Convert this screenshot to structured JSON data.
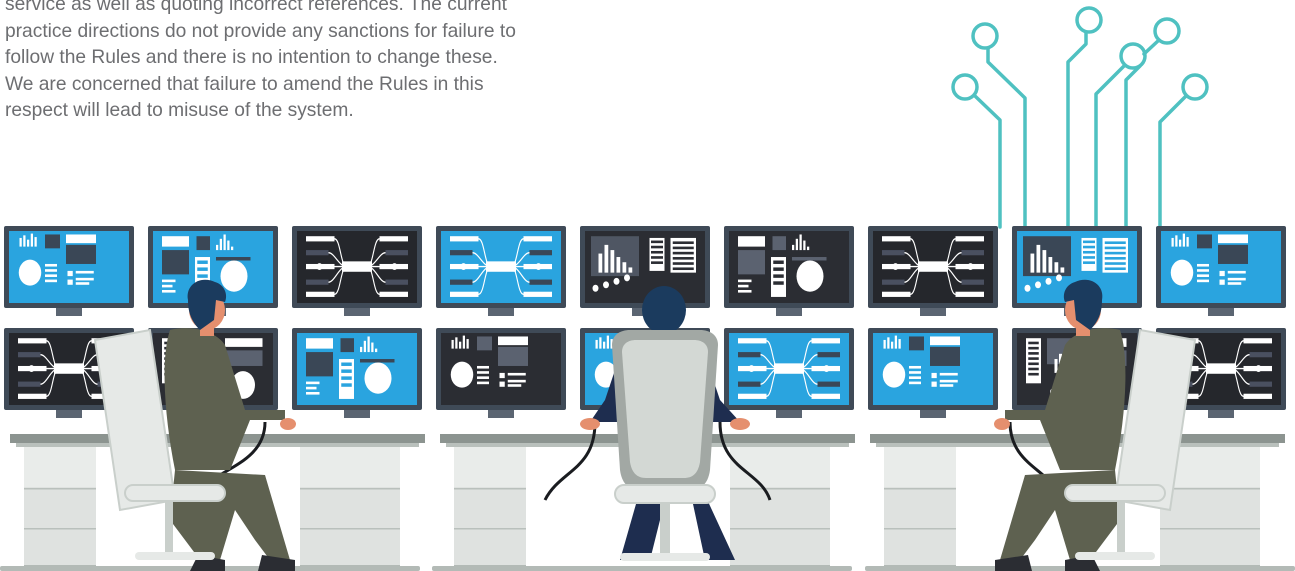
{
  "text_block": {
    "lines": [
      "service as well as quoting incorrect references. The current",
      "practice directions do not provide any sanctions for failure to",
      "follow the Rules and there is no intention to change these.",
      "We are concerned that failure to amend the Rules in this",
      "respect will lead to misuse of the system."
    ]
  },
  "colors": {
    "text": "#6d6e71",
    "teal": "#4fc1c1",
    "screen_dark": "#2b2d33",
    "screen_blue": "#2aa4df",
    "bezel": "#3f4a57",
    "skin": "#e58f6e",
    "hair": "#1b3b5e",
    "shirt_olive": "#5e6150",
    "shirt_navy": "#1e2d4f",
    "desk": "#dfe2e0",
    "chair": "#e6e9e7"
  },
  "icons": {
    "circuit": "circuit-tree-icon",
    "monitor_styles": [
      "dashboard",
      "flow",
      "report",
      "bars",
      "gauge"
    ]
  }
}
